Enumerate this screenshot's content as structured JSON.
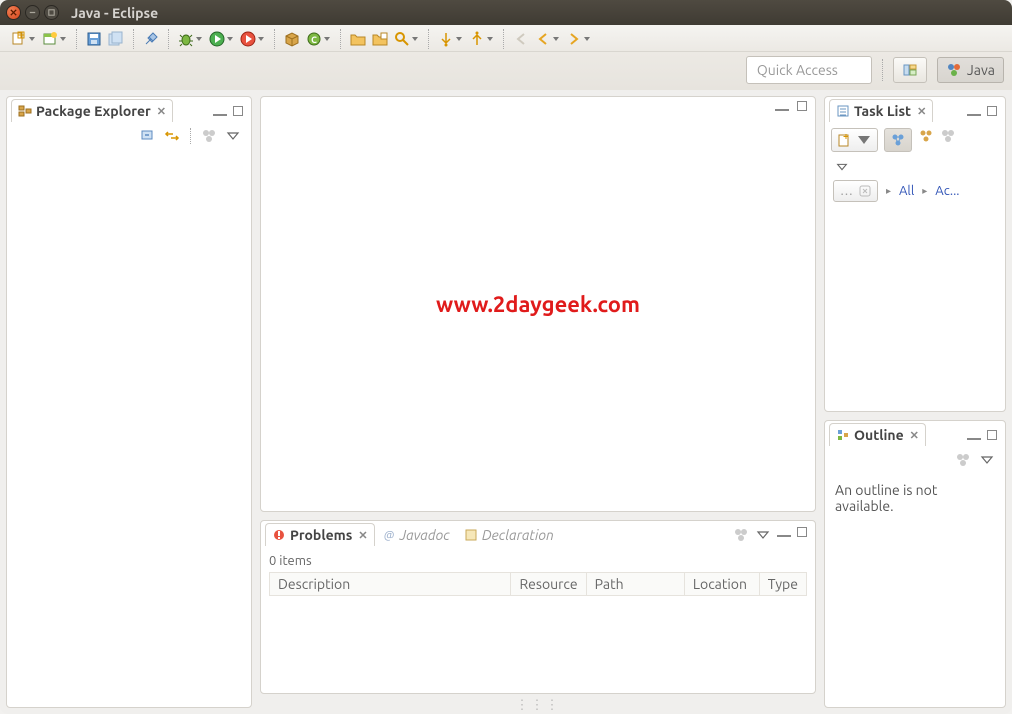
{
  "window": {
    "title": "Java - Eclipse"
  },
  "quick_access": {
    "placeholder": "Quick Access"
  },
  "perspective": {
    "java": "Java"
  },
  "views": {
    "package_explorer": {
      "title": "Package Explorer"
    },
    "task_list": {
      "title": "Task List"
    },
    "outline": {
      "title": "Outline",
      "message": "An outline is not available."
    },
    "problems": {
      "title": "Problems",
      "items_count": "0 items"
    },
    "javadoc": {
      "title": "Javadoc"
    },
    "declaration": {
      "title": "Declaration"
    }
  },
  "task_filters": {
    "placeholder": "…",
    "all": "All",
    "activate": "Ac..."
  },
  "table": {
    "columns": [
      "Description",
      "Resource",
      "Path",
      "Location",
      "Type"
    ]
  },
  "watermark": "www.2daygeek.com",
  "icons": {
    "new_project": "new-project-icon",
    "save": "save-icon",
    "debug": "debug-icon",
    "run": "run-icon"
  }
}
